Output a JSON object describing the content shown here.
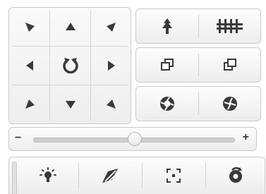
{
  "colors": {
    "icon": "#3a3a3a",
    "border": "#c9c9c9",
    "panel_top": "#fafafa",
    "panel_bottom": "#eeeeee",
    "track": "#cfcfcf"
  },
  "ptz": {
    "cells": [
      {
        "name": "pan-up-left-button",
        "icon": "arrow-up-left-icon"
      },
      {
        "name": "pan-up-button",
        "icon": "arrow-up-icon"
      },
      {
        "name": "pan-up-right-button",
        "icon": "arrow-up-right-icon"
      },
      {
        "name": "pan-left-button",
        "icon": "arrow-left-icon"
      },
      {
        "name": "auto-rotate-button",
        "icon": "refresh-icon"
      },
      {
        "name": "pan-right-button",
        "icon": "arrow-right-icon"
      },
      {
        "name": "pan-down-left-button",
        "icon": "arrow-down-left-icon"
      },
      {
        "name": "pan-down-button",
        "icon": "arrow-down-icon"
      },
      {
        "name": "pan-down-right-button",
        "icon": "arrow-down-right-icon"
      }
    ]
  },
  "controls": {
    "rows": [
      {
        "left": "focus-near-icon",
        "right": "focus-far-icon"
      },
      {
        "left": "zoom-out-icon",
        "right": "zoom-in-icon"
      },
      {
        "left": "iris-open-icon",
        "right": "iris-close-icon"
      }
    ]
  },
  "speed_slider": {
    "min_label": "−",
    "max_label": "+",
    "value_fraction": 0.5
  },
  "toolbar": {
    "items": [
      "light-icon",
      "wiper-icon",
      "focus-frame-icon",
      "preset-icon"
    ]
  }
}
